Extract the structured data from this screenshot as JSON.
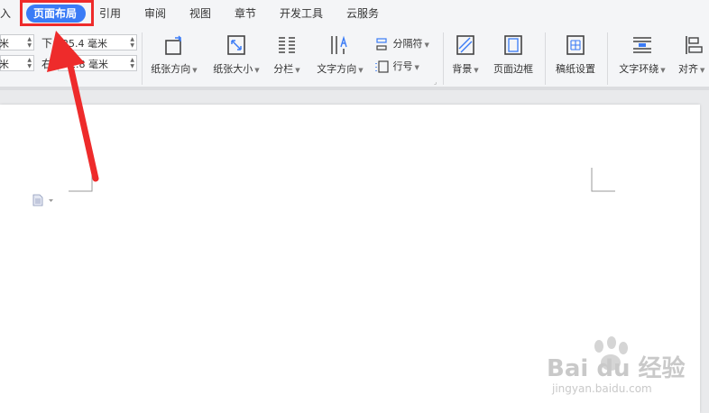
{
  "menu": {
    "items": [
      {
        "label": "入"
      },
      {
        "label": "页面布局"
      },
      {
        "label": "引用"
      },
      {
        "label": "审阅"
      },
      {
        "label": "视图"
      },
      {
        "label": "章节"
      },
      {
        "label": "开发工具"
      },
      {
        "label": "云服务"
      }
    ],
    "active_index": 1
  },
  "margins": {
    "left_top_value": "米",
    "left_bottom_value": "米",
    "bottom_label": "下:",
    "bottom_value": "25.4 毫米",
    "right_label": "右:",
    "right_value": "1.8 毫米"
  },
  "ribbon": {
    "orientation": "纸张方向",
    "size": "纸张大小",
    "columns": "分栏",
    "text_direction": "文字方向",
    "breaks": "分隔符",
    "line_numbers": "行号",
    "background": "背景",
    "page_border": "页面边框",
    "manuscript": "稿纸设置",
    "wrap_text": "文字环绕",
    "align": "对齐"
  },
  "watermark": {
    "brand": "Bai du 经验",
    "url": "jingyan.baidu.com"
  },
  "colors": {
    "accent": "#3a7bf6",
    "annotation": "#ee2b2b"
  },
  "icons": [
    "orientation-icon",
    "paper-size-icon",
    "columns-icon",
    "text-direction-icon",
    "breaks-icon",
    "line-number-icon",
    "background-icon",
    "page-border-icon",
    "manuscript-icon",
    "wrap-text-icon",
    "align-icon",
    "doc-icon"
  ]
}
